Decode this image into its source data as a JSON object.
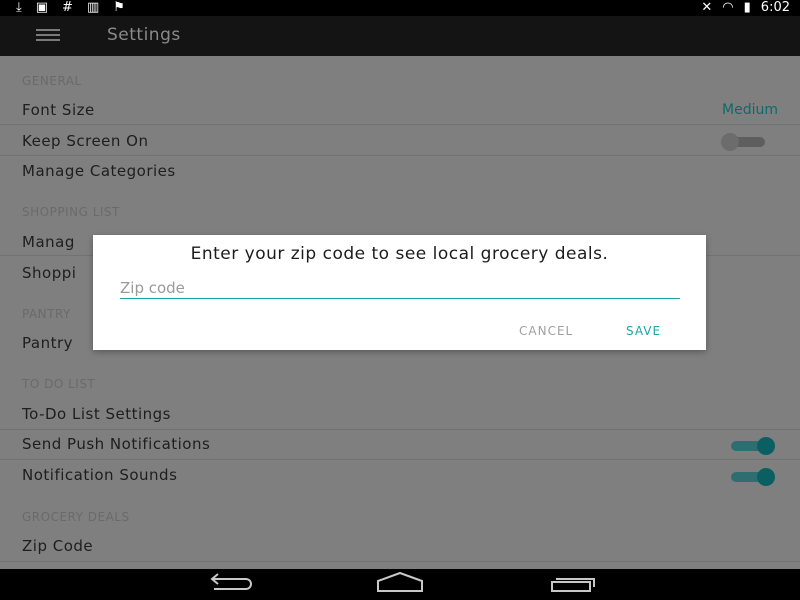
{
  "status_bar": {
    "icons_left": [
      "download-icon",
      "image-icon",
      "hash-icon",
      "barcode-icon",
      "flag-icon"
    ],
    "icons_right": [
      "mute-icon",
      "wifi-icon",
      "battery-icon"
    ],
    "time": "6:02"
  },
  "toolbar": {
    "title": "Settings"
  },
  "sections": {
    "general": {
      "header": "GENERAL",
      "font_size": {
        "label": "Font Size",
        "value": "Medium"
      },
      "keep_screen_on": {
        "label": "Keep Screen On",
        "enabled": false
      },
      "manage_categories": {
        "label": "Manage Categories"
      }
    },
    "shopping_list": {
      "header": "SHOPPING LIST",
      "item1": {
        "label": "Manag"
      },
      "item2": {
        "label": "Shoppi"
      }
    },
    "pantry": {
      "header": "PANTRY",
      "item1": {
        "label": "Pantry"
      }
    },
    "todo": {
      "header": "TO DO LIST",
      "settings": {
        "label": "To-Do List Settings"
      },
      "push": {
        "label": "Send Push Notifications",
        "enabled": true
      },
      "sounds": {
        "label": "Notification Sounds",
        "enabled": true
      }
    },
    "grocery": {
      "header": "GROCERY DEALS",
      "zip": {
        "label": "Zip Code"
      }
    }
  },
  "dialog": {
    "message": "Enter your zip code to see local grocery deals.",
    "input_placeholder": "Zip code",
    "input_value": "",
    "cancel_label": "CANCEL",
    "save_label": "SAVE"
  },
  "nav_bar": {
    "icons": [
      "back-icon",
      "home-icon",
      "recents-icon"
    ]
  },
  "colors": {
    "accent": "#1ea5a5",
    "toolbar": "#141414",
    "scrim": "#7f7f7f"
  }
}
